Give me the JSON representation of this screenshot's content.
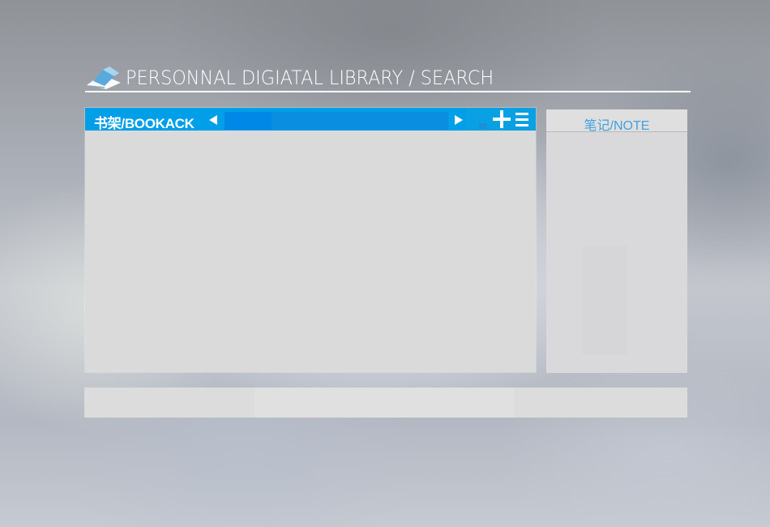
{
  "header": {
    "title": "PERSONNAL DIGIATAL LIBRARY / SEARCH",
    "logo_icon": "open-book-icon"
  },
  "bookcase": {
    "title": "书架/BOOKACK",
    "prev_icon": "arrow-left-icon",
    "next_icon": "arrow-right-icon",
    "add_icon": "plus-icon",
    "menu_icon": "menu-icon",
    "accent_color": "#009fe8"
  },
  "note": {
    "title": "笔记/NOTE",
    "title_color": "#3fa2df"
  }
}
